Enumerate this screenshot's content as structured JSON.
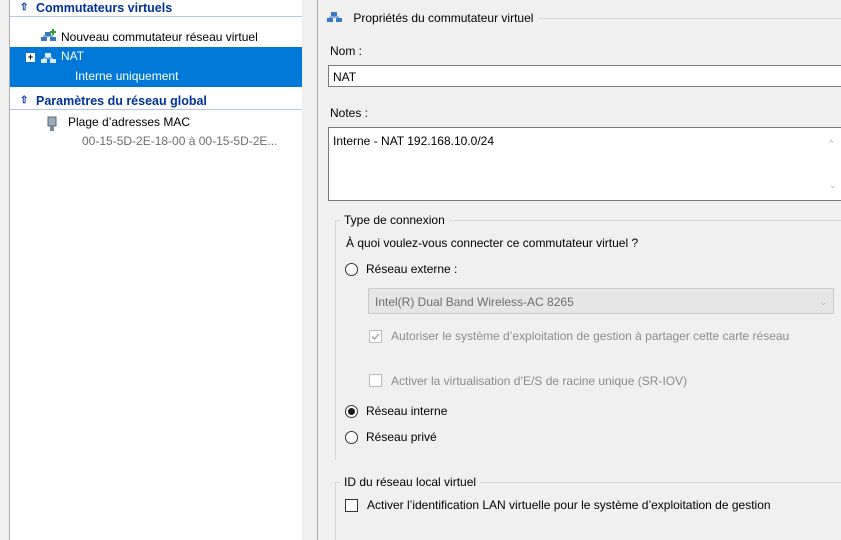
{
  "tree": {
    "section_virtual_switches": "Commutateurs virtuels",
    "new_switch": "Nouveau commutateur réseau virtuel",
    "nat_name": "NAT",
    "nat_type": "Interne uniquement",
    "section_global": "Paramètres du réseau global",
    "mac_range_label": "Plage d’adresses MAC",
    "mac_range_value": "00-15-5D-2E-18-00 à 00-15-5D-2E..."
  },
  "props": {
    "title": "Propriétés du commutateur virtuel",
    "name_label": "Nom :",
    "name_value": "NAT",
    "notes_label": "Notes :",
    "notes_value": "Interne - NAT 192.168.10.0/24",
    "connection_type_title": "Type de connexion",
    "connection_question": "À quoi voulez-vous connecter ce commutateur virtuel ?",
    "radio_external": "Réseau externe :",
    "adapter_value": "Intel(R) Dual Band Wireless-AC 8265",
    "allow_mgmt_os": "Autoriser le système d’exploitation de gestion à partager cette carte réseau",
    "sriov": "Activer la virtualisation d’E/S de racine unique (SR-IOV)",
    "radio_internal": "Réseau interne",
    "radio_private": "Réseau privé",
    "vlan_title": "ID du réseau local virtuel",
    "vlan_checkbox": "Activer l’identification LAN virtuelle pour le système d’exploitation de gestion",
    "selected_connection": "Réseau interne"
  }
}
